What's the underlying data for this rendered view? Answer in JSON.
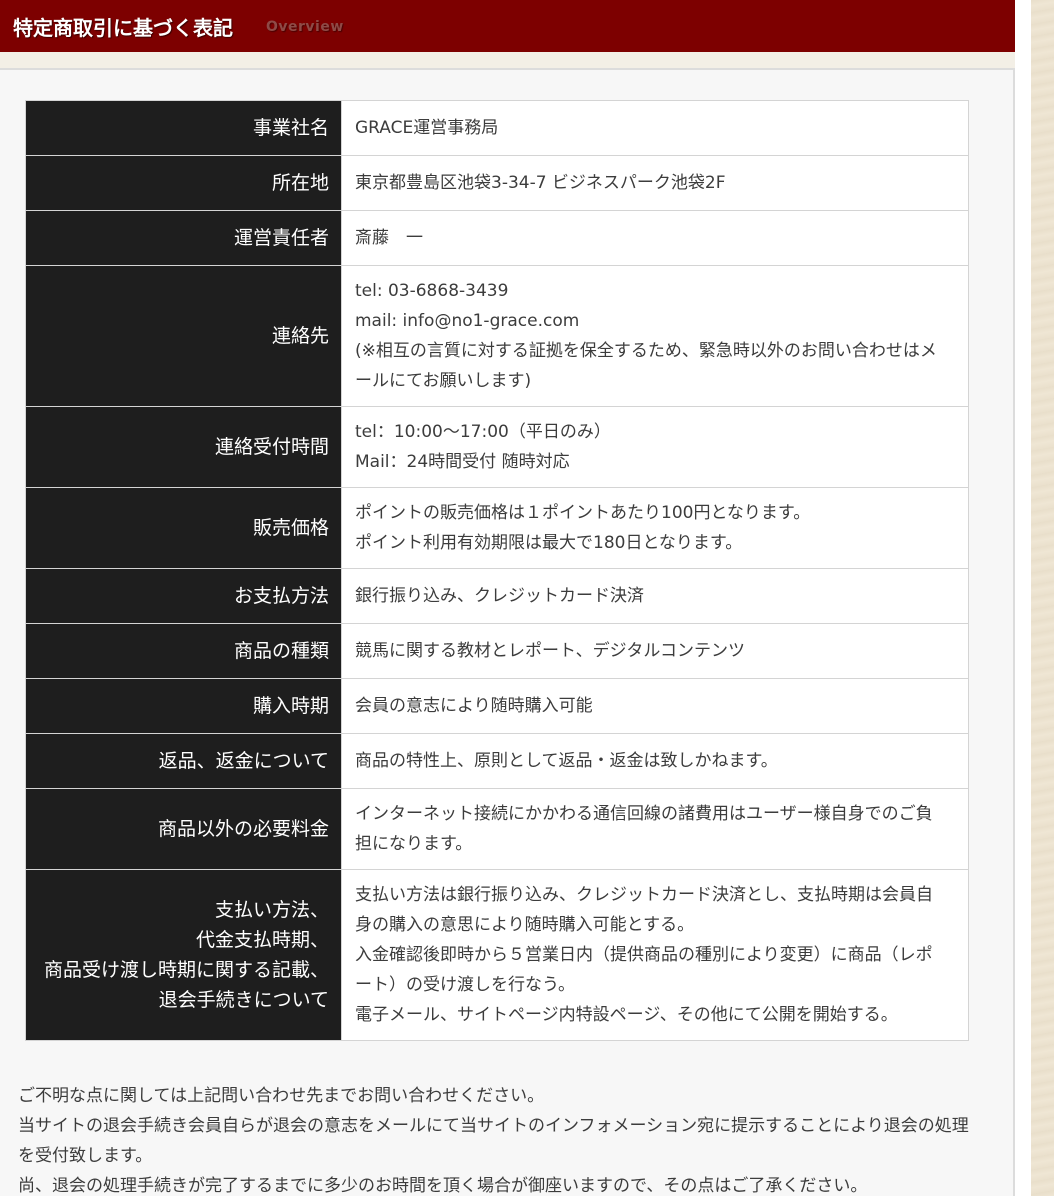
{
  "header": {
    "title": "特定商取引に基づく表記",
    "subtitle": "Overview"
  },
  "rows": [
    {
      "label": [
        "事業社名"
      ],
      "value": [
        "GRACE運営事務局"
      ]
    },
    {
      "label": [
        "所在地"
      ],
      "value": [
        "東京都豊島区池袋3-34-7 ビジネスパーク池袋2F"
      ]
    },
    {
      "label": [
        "運営責任者"
      ],
      "value": [
        "斎藤　一"
      ]
    },
    {
      "label": [
        "連絡先"
      ],
      "value": [
        "tel: 03-6868-3439",
        "mail: info@no1-grace.com",
        "(※相互の言質に対する証拠を保全するため、緊急時以外のお問い合わせはメールにてお願いします)"
      ]
    },
    {
      "label": [
        "連絡受付時間"
      ],
      "value": [
        "tel：10:00〜17:00（平日のみ）",
        "Mail：24時間受付 随時対応"
      ]
    },
    {
      "label": [
        "販売価格"
      ],
      "value": [
        "ポイントの販売価格は１ポイントあたり100円となります。",
        "ポイント利用有効期限は最大で180日となります。"
      ]
    },
    {
      "label": [
        "お支払方法"
      ],
      "value": [
        "銀行振り込み、クレジットカード決済"
      ]
    },
    {
      "label": [
        "商品の種類"
      ],
      "value": [
        "競馬に関する教材とレポート、デジタルコンテンツ"
      ]
    },
    {
      "label": [
        "購入時期"
      ],
      "value": [
        "会員の意志により随時購入可能"
      ]
    },
    {
      "label": [
        "返品、返金について"
      ],
      "value": [
        "商品の特性上、原則として返品・返金は致しかねます。"
      ]
    },
    {
      "label": [
        "商品以外の必要料金"
      ],
      "value": [
        "インターネット接続にかかわる通信回線の諸費用はユーザー様自身でのご負担になります。"
      ]
    },
    {
      "label": [
        "支払い方法、",
        "代金支払時期、",
        "商品受け渡し時期に関する記載、",
        "退会手続きについて"
      ],
      "value": [
        "支払い方法は銀行振り込み、クレジットカード決済とし、支払時期は会員自身の購入の意思により随時購入可能とする。",
        "入金確認後即時から５営業日内（提供商品の種別により変更）に商品（レポート）の受け渡しを行なう。",
        "電子メール、サイトページ内特設ページ、その他にて公開を開始する。"
      ]
    }
  ],
  "footer_notes": [
    "ご不明な点に関しては上記問い合わせ先までお問い合わせください。",
    "当サイトの退会手続き会員自らが退会の意志をメールにて当サイトのインフォメーション宛に提示することにより退会の処理を受付致します。",
    "尚、退会の処理手続きが完了するまでに多少のお時間を頂く場合が御座いますので、その点はご了承ください。"
  ]
}
